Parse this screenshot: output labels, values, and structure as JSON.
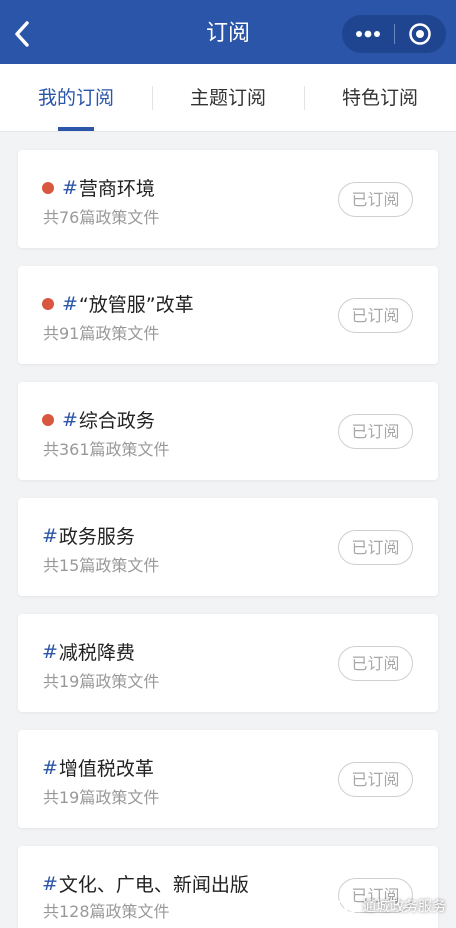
{
  "header": {
    "title": "订阅",
    "back_icon": "chevron-left-icon",
    "more_icon": "more-dots-icon",
    "target_icon": "target-icon",
    "color": "#2a55a8"
  },
  "tabs": [
    {
      "label": "我的订阅",
      "active": true
    },
    {
      "label": "主题订阅",
      "active": false
    },
    {
      "label": "特色订阅",
      "active": false
    }
  ],
  "subscriptions": [
    {
      "title": "营商环境",
      "count_text": "共76篇政策文件",
      "has_dot": true,
      "button": "已订阅"
    },
    {
      "title": "“放管服”改革",
      "count_text": "共91篇政策文件",
      "has_dot": true,
      "button": "已订阅"
    },
    {
      "title": "综合政务",
      "count_text": "共361篇政策文件",
      "has_dot": true,
      "button": "已订阅"
    },
    {
      "title": "政务服务",
      "count_text": "共15篇政策文件",
      "has_dot": false,
      "button": "已订阅"
    },
    {
      "title": "减税降费",
      "count_text": "共19篇政策文件",
      "has_dot": false,
      "button": "已订阅"
    },
    {
      "title": "增值税改革",
      "count_text": "共19篇政策文件",
      "has_dot": false,
      "button": "已订阅"
    },
    {
      "title": "文化、广电、新闻出版",
      "count_text": "共128篇政策文件",
      "has_dot": false,
      "button": "已订阅"
    }
  ],
  "hash_symbol": "#",
  "watermark": {
    "text": "通城政务服务",
    "icon": "wechat-icon"
  },
  "colors": {
    "accent": "#2a55a8",
    "dot": "#d9573e",
    "background": "#f2f3f5"
  }
}
